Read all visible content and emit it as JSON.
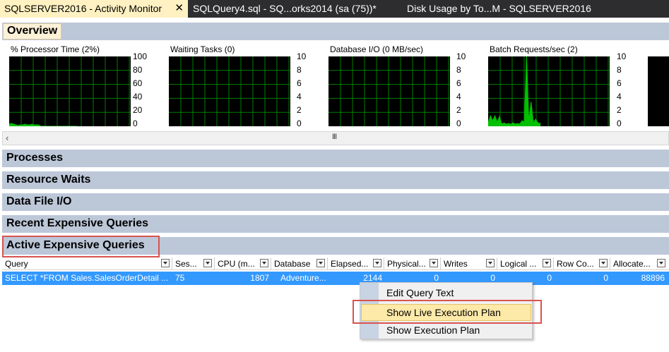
{
  "tabs": [
    {
      "label": "SQLSERVER2016 - Activity Monitor",
      "close": "✕"
    },
    {
      "label": "SQLQuery4.sql - SQ...orks2014 (sa (75))*"
    },
    {
      "label": "Disk Usage by To...M - SQLSERVER2016"
    }
  ],
  "overview": {
    "label": "Overview",
    "graphs": [
      {
        "title": "% Processor Time (2%)",
        "ticks": [
          "100",
          "80",
          "60",
          "40",
          "20",
          "0"
        ],
        "max": 100,
        "series": [
          3,
          4,
          3,
          2,
          1,
          2,
          2,
          3,
          2,
          2,
          3,
          2,
          2,
          2,
          0,
          0,
          0,
          0,
          0,
          0,
          0,
          0,
          0,
          0,
          0,
          0,
          0,
          0,
          0,
          0,
          0
        ]
      },
      {
        "title": "Waiting Tasks (0)",
        "ticks": [
          "10",
          "8",
          "6",
          "4",
          "2",
          "0"
        ],
        "max": 10,
        "series": []
      },
      {
        "title": "Database I/O (0 MB/sec)",
        "ticks": [
          "10",
          "8",
          "6",
          "4",
          "2",
          "0"
        ],
        "max": 10,
        "series": []
      },
      {
        "title": "Batch Requests/sec (2)",
        "ticks": [
          "10",
          "8",
          "6",
          "4",
          "2",
          "0"
        ],
        "max": 10,
        "series": [
          0.5,
          1.5,
          0.8,
          1.5,
          0.6,
          1.4,
          0.3,
          0.5,
          0.3,
          0.4,
          0.3,
          0.5,
          0.3,
          0.4,
          0.3,
          0.8,
          0.6,
          10,
          0.8,
          3.5,
          0.5,
          1.0,
          0.5,
          0.4
        ]
      }
    ]
  },
  "sections": {
    "processes": "Processes",
    "resource_waits": "Resource Waits",
    "data_file_io": "Data File I/O",
    "recent_expensive": "Recent Expensive Queries",
    "active_expensive": "Active Expensive Queries"
  },
  "grid": {
    "columns": [
      "Query",
      "Ses...",
      "CPU (m...",
      "Database",
      "Elapsed...",
      "Physical...",
      "Writes",
      "Logical ...",
      "Row Co...",
      "Allocate..."
    ],
    "row": {
      "query": "SELECT *FROM Sales.SalesOrderDetail ...",
      "session": "75",
      "cpu": "1807",
      "database": "Adventure...",
      "elapsed": "2144",
      "physical": "0",
      "writes": "0",
      "logical": "0",
      "row_count": "0",
      "allocated": "88896"
    }
  },
  "context_menu": {
    "items": [
      "Edit Query Text",
      "Show Live Execution Plan",
      "Show Execution Plan"
    ]
  },
  "colors": {
    "tab_bg": "#2d2d30",
    "active_tab": "#fff1c2",
    "section_bg": "#bcc7d8",
    "selection": "#3399ff",
    "graph_line": "#00c000",
    "grid_line": "#008000",
    "highlight_box": "#d9534f"
  }
}
